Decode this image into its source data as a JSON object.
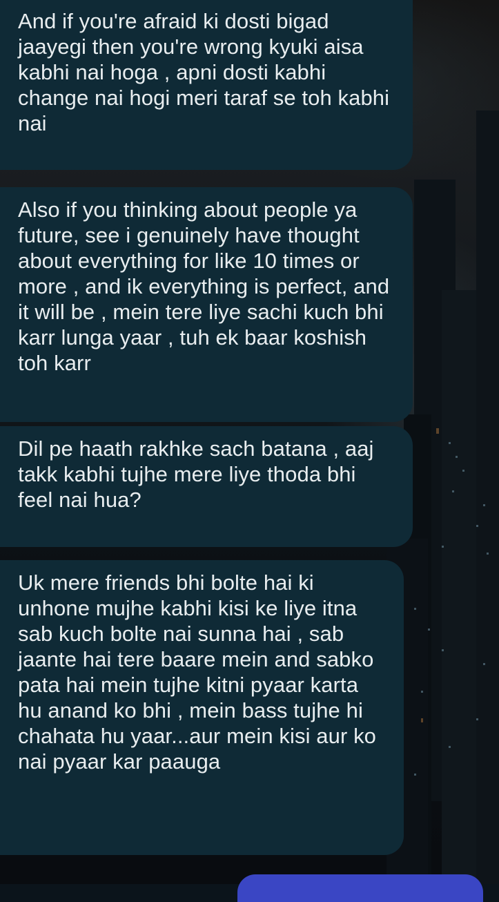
{
  "messages": [
    {
      "direction": "incoming",
      "text": "And if you're afraid ki dosti bigad jaayegi then you're wrong kyuki aisa kabhi nai hoga , apni dosti kabhi change nai hogi meri taraf se toh kabhi nai"
    },
    {
      "direction": "incoming",
      "text": "Also if you thinking about people ya future, see i genuinely have thought about everything for like 10 times or more , and ik everything is perfect, and it will be , mein tere liye sachi kuch bhi karr lunga yaar , tuh ek baar koshish toh karr"
    },
    {
      "direction": "incoming",
      "text": "Dil pe haath rakhke sach batana , aaj takk kabhi tujhe mere liye thoda bhi feel nai hua?"
    },
    {
      "direction": "incoming",
      "text": "Uk mere friends bhi bolte hai ki unhone mujhe kabhi kisi ke liye itna sab kuch bolte nai sunna hai , sab jaante hai tere baare mein and sabko pata hai mein tujhe kitni pyaar karta hu anand ko bhi , mein bass tujhe hi chahata hu yaar...aur mein kisi aur ko nai pyaar kar paauga"
    }
  ],
  "colors": {
    "incoming_bubble": "#0f2a36",
    "outgoing_bubble": "#3a46c4",
    "text": "#e8edef"
  }
}
